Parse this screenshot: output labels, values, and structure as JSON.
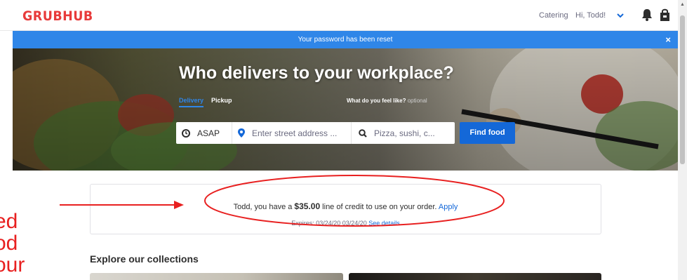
{
  "header": {
    "logo": "GRUBHUB",
    "catering": "Catering",
    "greeting": "Hi, Todd!"
  },
  "banner": {
    "message": "Your password has been reset",
    "close": "×"
  },
  "hero": {
    "title": "Who delivers to your workplace?",
    "tabs": [
      "Delivery",
      "Pickup"
    ],
    "feel_label": "What do you feel like?",
    "feel_optional": "optional"
  },
  "search": {
    "time": "ASAP",
    "address_placeholder": "Enter street address ...",
    "food_placeholder": "Pizza, sushi, c...",
    "button": "Find food"
  },
  "credit": {
    "prefix": "Todd, you have a ",
    "amount": "$35.00",
    "suffix": " line of credit  to use on your order. ",
    "apply": "Apply",
    "expires": "Expires: 03/24/20 03/24/20 ",
    "details": "See details"
  },
  "collections": {
    "title": "Explore our collections"
  },
  "annotation": {
    "side_lines": [
      "ed",
      "od",
      "our"
    ]
  },
  "colors": {
    "brand": "#e83a3a",
    "accent": "#1468d8",
    "banner": "#2f86e8",
    "annotation": "#e82020"
  }
}
